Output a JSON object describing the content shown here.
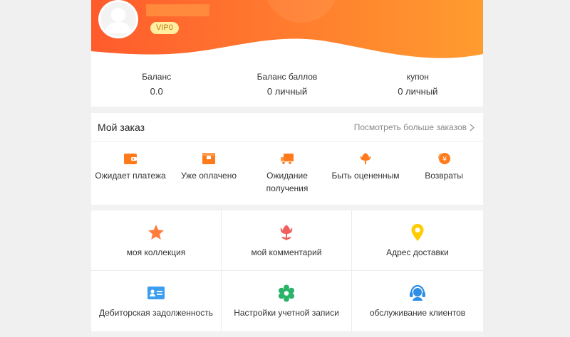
{
  "profile": {
    "vip_label": "VIP0"
  },
  "balance": [
    {
      "label": "Баланс",
      "value": "0.0"
    },
    {
      "label": "Баланс баллов",
      "value": "0 личный"
    },
    {
      "label": "купон",
      "value": "0 личный"
    }
  ],
  "orders": {
    "title": "Мой заказ",
    "more_label": "Посмотреть больше заказов",
    "items": [
      {
        "label": "Ожидает платежа",
        "icon": "wallet-icon"
      },
      {
        "label": "Уже оплачено",
        "icon": "box-icon"
      },
      {
        "label": "Ожидание получения",
        "icon": "truck-icon"
      },
      {
        "label": "Быть оцененным",
        "icon": "flower-icon"
      },
      {
        "label": "Возвраты",
        "icon": "refund-icon"
      }
    ]
  },
  "services": [
    {
      "label": "моя коллекция",
      "icon": "star-icon"
    },
    {
      "label": "мой комментарий",
      "icon": "tulip-icon"
    },
    {
      "label": "Адрес доставки",
      "icon": "location-pin-icon"
    },
    {
      "label": "Дебиторская задолженность",
      "icon": "id-card-icon"
    },
    {
      "label": "Настройки учетной записи",
      "icon": "gear-icon"
    },
    {
      "label": "обслуживание клиентов",
      "icon": "headset-icon"
    }
  ],
  "colors": {
    "header_gradient_start": "#ff5a2c",
    "header_gradient_end": "#ff9a2e",
    "order_icon": "#ff7a1a",
    "star": "#ff7a3d",
    "tulip": "#f0605f",
    "pin": "#ffcc00",
    "id_card": "#3c9ef0",
    "gear": "#2cb36a",
    "headset": "#2f8ee6"
  }
}
